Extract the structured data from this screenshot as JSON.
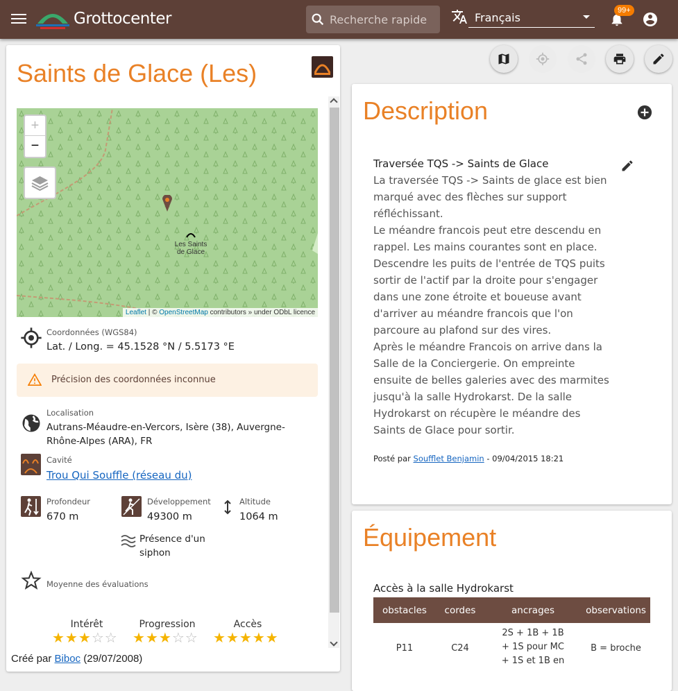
{
  "header": {
    "brand": "Grottocenter",
    "search_placeholder": "Recherche rapide",
    "language": "Français",
    "notif_badge": "99+"
  },
  "cave": {
    "title": "Saints de Glace (Les)",
    "map": {
      "zoom_in": "+",
      "zoom_out": "−",
      "label_line1": "Les Saints",
      "label_line2": "de Glace",
      "attribution_leaflet": "Leaflet",
      "attribution_sep": " | © ",
      "attribution_osm": "OpenStreetMap",
      "attribution_rest": " contributors » under ODbL licence"
    },
    "coords_label": "Coordonnées (WGS84)",
    "coords_value": "Lat. / Long. = 45.1528 °N / 5.5173 °E",
    "precision_warning": "Précision des coordonnées inconnue",
    "location_label": "Localisation",
    "location_value": "Autrans-Méaudre-en-Vercors, Isère (38), Auvergne-Rhône-Alpes (ARA), FR",
    "cavity_label": "Cavité",
    "cavity_value": "Trou Qui Souffle (réseau du)",
    "depth_label": "Profondeur",
    "depth_value": "670 m",
    "length_label": "Développement",
    "length_value": "49300 m",
    "altitude_label": "Altitude",
    "altitude_value": "1064 m",
    "siphon_line1": "Présence d'un",
    "siphon_line2": "siphon",
    "rating_label": "Moyenne des évaluations",
    "ratings": [
      {
        "label": "Intérêt",
        "value": 3,
        "max": 5
      },
      {
        "label": "Progression",
        "value": 3,
        "max": 5
      },
      {
        "label": "Accès",
        "value": 5,
        "max": 5
      }
    ],
    "created_prefix": "Créé par ",
    "created_author": "Biboc",
    "created_date": " (29/07/2008)"
  },
  "description": {
    "title": "Description",
    "subtitle": "Traversée TQS -> Saints de Glace",
    "body": "La traversée TQS -> Saints de glace est bien marqué avec des flèches sur support réfléchissant.\nLe méandre francois peut etre descendu en rappel. Les mains courantes sont en place. Descendre les puits de l'entrée de TQS puits sortir de l'actif par la droite pour s'engager dans une zone étroite et boueuse avant d'arriver au méandre francois que l'on parcoure au plafond sur des vires.\nAprès le méandre Francois on arrive dans la Salle de la Conciergerie. On empreinte ensuite de belles galeries avec des marmites jusqu'à la salle Hydrokarst. De la salle Hydrokarst on récupère le méandre des Saints de Glace pour sortir.",
    "posted_prefix": "Posté par ",
    "posted_author": "Soufflet Benjamin",
    "posted_date": " - 09/04/2015 18:21"
  },
  "equipment": {
    "title": "Équipement",
    "subtitle": "Accès à la salle Hydrokarst",
    "columns": [
      "obstacles",
      "cordes",
      "ancrages",
      "observations"
    ],
    "rows": [
      [
        "P11",
        "C24",
        "2S + 1B + 1B + 1S pour MC + 1S et 1B en",
        "B = broche"
      ]
    ]
  },
  "colors": {
    "header_bg": "#5d4037",
    "accent_orange": "#e98126",
    "table_header_bg": "#6d4c41",
    "star_on": "#f5b400",
    "warning_bg": "#fdf1e3"
  }
}
